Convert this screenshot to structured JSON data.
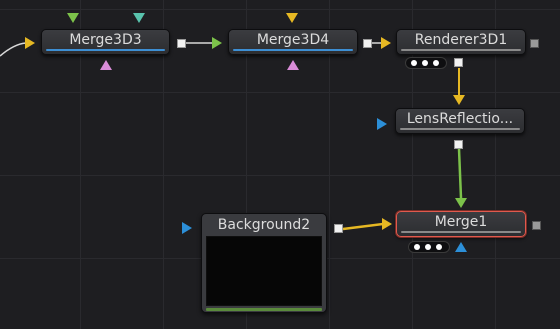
{
  "nodes": {
    "merge3d3": {
      "label": "Merge3D3"
    },
    "merge3d4": {
      "label": "Merge3D4"
    },
    "renderer3d1": {
      "label": "Renderer3D1"
    },
    "lensreflection": {
      "label": "LensReflectio..."
    },
    "background2": {
      "label": "Background2"
    },
    "merge1": {
      "label": "Merge1",
      "state": "selected"
    }
  },
  "colors": {
    "canvas_bg": "#1e1e21",
    "node_fill": "#3b3c40",
    "input_yellow": "#e6b823",
    "input_green": "#7cc24a",
    "input_blue": "#2c8fd8",
    "input_teal": "#59c3ad",
    "input_pink": "#d98cd8",
    "link_white": "#d8d8d8",
    "link_yellow": "#e6b823",
    "link_green": "#7cc24a",
    "selected_outline": "#e05a4e",
    "active_underline": "#3d8fd4"
  },
  "icons": {
    "input_ports": "triangle",
    "output_ports": "square",
    "view_indicators": "dots-pill"
  }
}
